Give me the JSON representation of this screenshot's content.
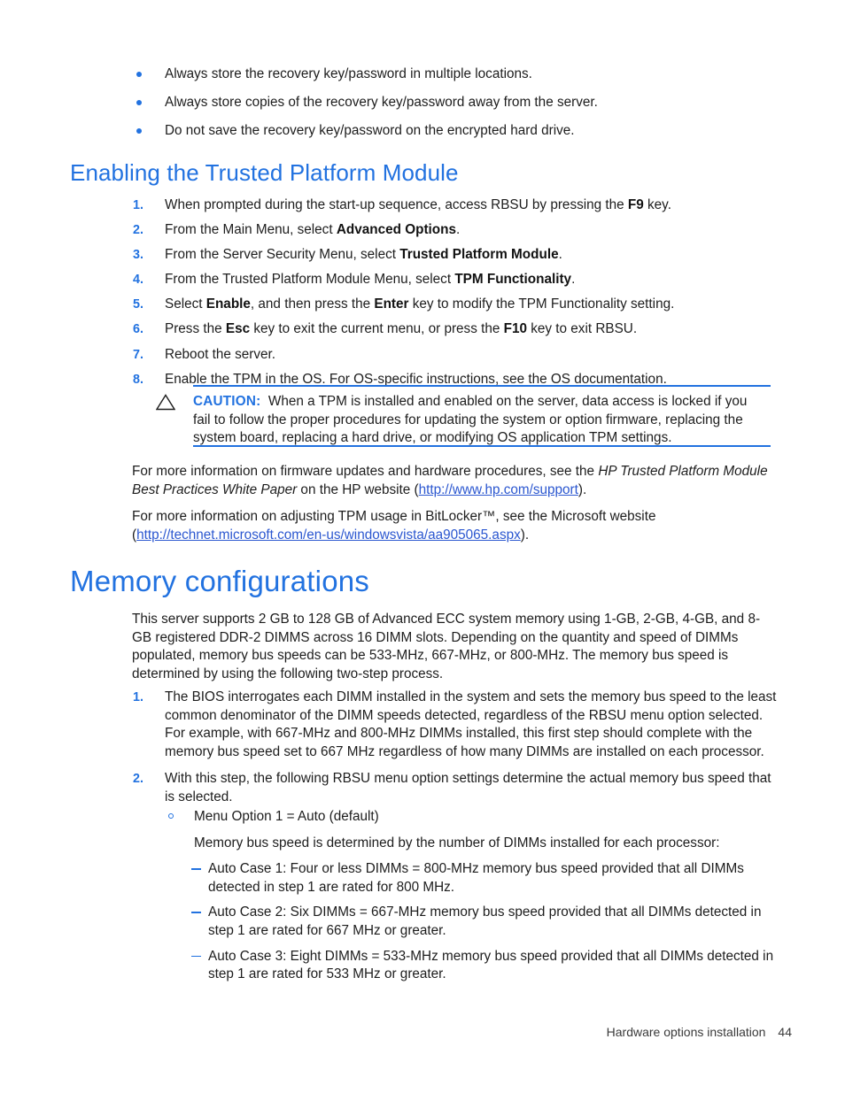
{
  "document": {
    "intro_bullets": [
      "Always store the recovery key/password in multiple locations.",
      "Always store copies of the recovery key/password away from the server.",
      "Do not save the recovery key/password on the encrypted hard drive."
    ],
    "section_tpm": {
      "heading": "Enabling the Trusted Platform Module",
      "steps": [
        {
          "number": "1.",
          "parts": [
            {
              "t": "When prompted during the start-up sequence, access RBSU by pressing the ",
              "b": false
            },
            {
              "t": "F9",
              "b": true
            },
            {
              "t": " key.",
              "b": false
            }
          ]
        },
        {
          "number": "2.",
          "parts": [
            {
              "t": "From the Main Menu, select ",
              "b": false
            },
            {
              "t": "Advanced Options",
              "b": true
            },
            {
              "t": ".",
              "b": false
            }
          ]
        },
        {
          "number": "3.",
          "parts": [
            {
              "t": "From the Server Security Menu, select ",
              "b": false
            },
            {
              "t": "Trusted Platform Module",
              "b": true
            },
            {
              "t": ".",
              "b": false
            }
          ]
        },
        {
          "number": "4.",
          "parts": [
            {
              "t": "From the Trusted Platform Module Menu, select ",
              "b": false
            },
            {
              "t": "TPM Functionality",
              "b": true
            },
            {
              "t": ".",
              "b": false
            }
          ]
        },
        {
          "number": "5.",
          "parts": [
            {
              "t": "Select ",
              "b": false
            },
            {
              "t": "Enable",
              "b": true
            },
            {
              "t": ", and then press the ",
              "b": false
            },
            {
              "t": "Enter",
              "b": true
            },
            {
              "t": " key to modify the TPM Functionality setting.",
              "b": false
            }
          ]
        },
        {
          "number": "6.",
          "parts": [
            {
              "t": "Press the ",
              "b": false
            },
            {
              "t": "Esc",
              "b": true
            },
            {
              "t": " key to exit the current menu, or press the ",
              "b": false
            },
            {
              "t": "F10",
              "b": true
            },
            {
              "t": " key to exit RBSU.",
              "b": false
            }
          ]
        },
        {
          "number": "7.",
          "parts": [
            {
              "t": "Reboot the server.",
              "b": false
            }
          ]
        },
        {
          "number": "8.",
          "parts": [
            {
              "t": "Enable the TPM in the OS. For OS-specific instructions, see the OS documentation.",
              "b": false
            }
          ]
        }
      ],
      "caution": {
        "icon": "warning-triangle-icon",
        "label": "CAUTION:",
        "text": "When a TPM is installed and enabled on the server, data access is locked if you fail to follow the proper procedures for updating the system or option firmware, replacing the system board, replacing a hard drive, or modifying OS application TPM settings."
      },
      "paragraph_1": {
        "lead": "For more information on firmware updates and hardware procedures, see the ",
        "italic": "HP Trusted Platform Module Best Practices White Paper",
        "mid": " on the HP website (",
        "link": "http://www.hp.com/support",
        "tail": ")."
      },
      "paragraph_2": {
        "lead": "For more information on adjusting TPM usage in BitLocker™, see the Microsoft website (",
        "link": "http://technet.microsoft.com/en-us/windowsvista/aa905065.aspx",
        "tail": ")."
      }
    },
    "section_memory": {
      "heading": "Memory configurations",
      "intro": "This server supports 2 GB to 128 GB of Advanced ECC system memory using 1-GB, 2-GB, 4-GB, and 8-GB registered DDR-2 DIMMS across 16 DIMM slots. Depending on the quantity and speed of DIMMs populated, memory bus speeds can be 533-MHz, 667-MHz, or 800-MHz. The memory bus speed is determined by using the following two-step process.",
      "steps": [
        {
          "number": "1.",
          "text": "The BIOS interrogates each DIMM installed in the system and sets the memory bus speed to the least common denominator of the DIMM speeds detected, regardless of the RBSU menu option selected. For example, with 667-MHz and 800-MHz DIMMs installed, this first step should complete with the memory bus speed set to 667 MHz regardless of how many DIMMs are installed on each processor."
        },
        {
          "number": "2.",
          "text": "With this step, the following RBSU menu option settings determine the actual memory bus speed that is selected."
        }
      ],
      "menu_option": "Menu Option 1 = Auto (default)",
      "menu_note": "Memory bus speed is determined by the number of DIMMs installed for each processor:",
      "auto_cases": [
        "Auto Case 1: Four or less DIMMs = 800-MHz memory bus speed provided that all DIMMs detected in step 1 are rated for 800 MHz.",
        "Auto Case 2: Six DIMMs = 667-MHz memory bus speed provided that all DIMMs detected in step 1 are rated for 667 MHz or greater.",
        "Auto Case 3: Eight DIMMs = 533-MHz memory bus speed provided that all DIMMs detected in step 1 are rated for 533 MHz or greater."
      ]
    },
    "footer": {
      "chapter": "Hardware options installation",
      "page_number": "44"
    },
    "colors": {
      "heading_blue": "#2272e0",
      "link_blue": "#2b57d0",
      "body_text": "#1d1d1d"
    }
  }
}
